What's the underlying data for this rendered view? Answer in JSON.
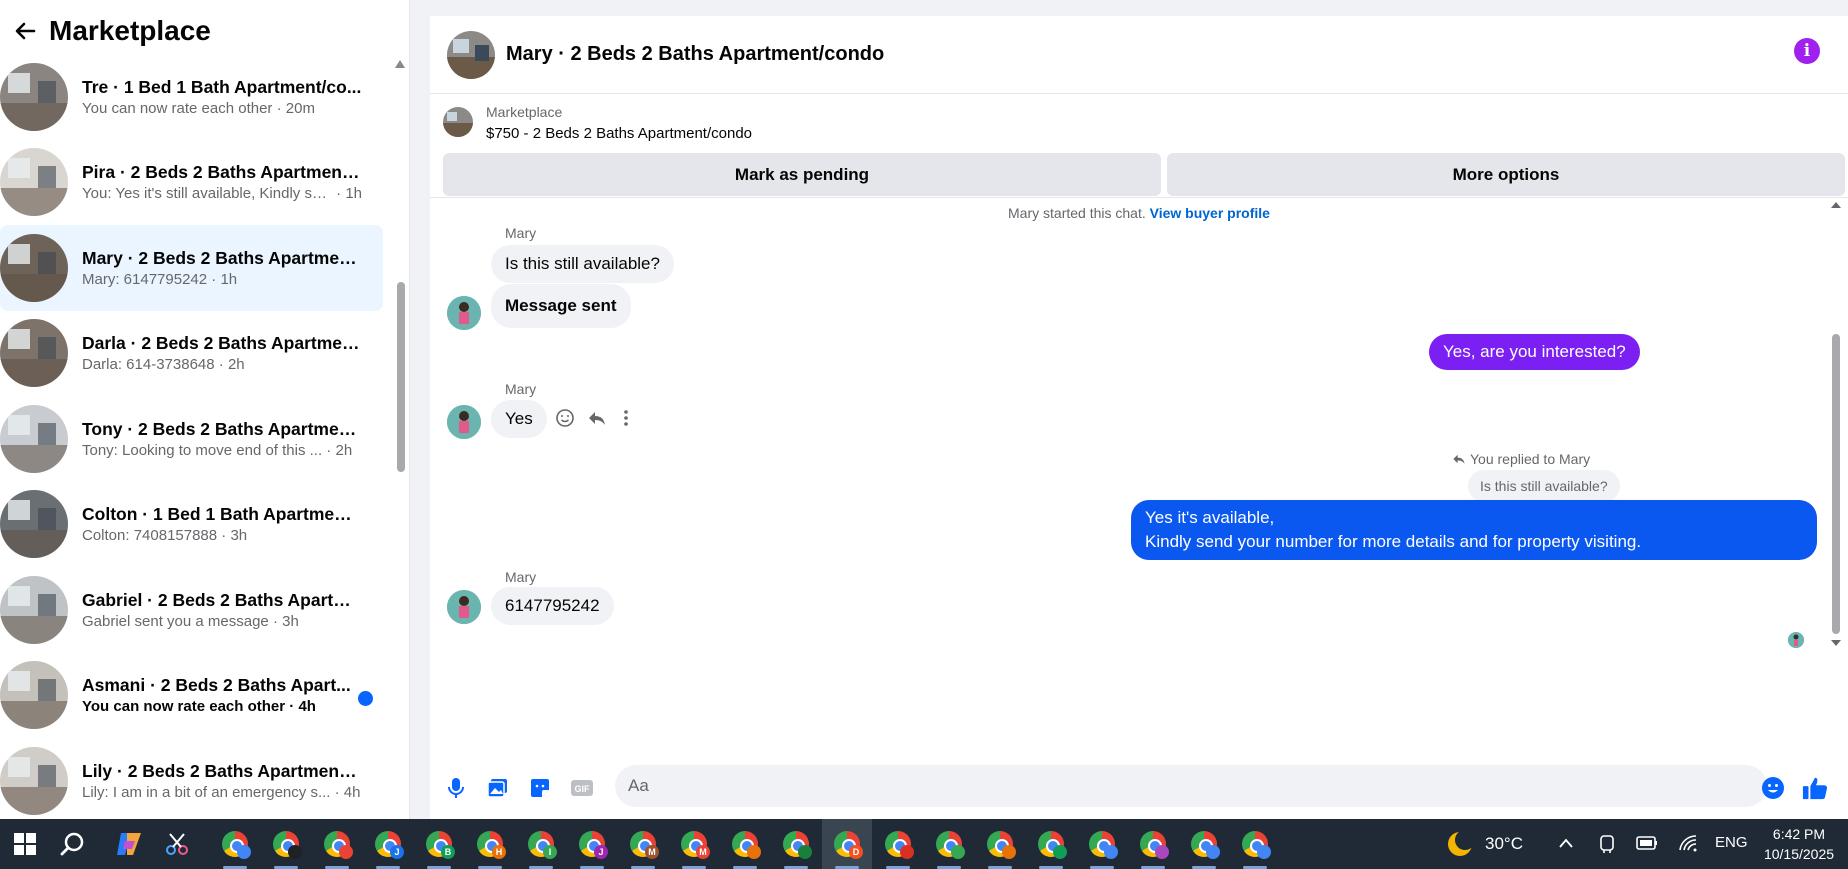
{
  "sidebar": {
    "title": "Marketplace",
    "conversations": [
      {
        "title": "Tre · 1 Bed 1 Bath Apartment/co...",
        "preview": "You can now rate each other",
        "time": "20m",
        "active": false,
        "unread": false
      },
      {
        "title": "Pirа · 2 Beds 2 Baths Apartment...",
        "preview": "You: Yes it's still available, Kindly se...",
        "time": "1h",
        "active": false,
        "unread": false
      },
      {
        "title": "Mary · 2 Beds 2 Baths Apartmen...",
        "preview": "Mary: 6147795242",
        "time": "1h",
        "active": true,
        "unread": false
      },
      {
        "title": "Darla · 2 Beds 2 Baths Apartmen...",
        "preview": "Darla: 614-3738648",
        "time": "2h",
        "active": false,
        "unread": false
      },
      {
        "title": "Tony · 2 Beds 2 Baths Apartmen...",
        "preview": "Tony: Looking to move end of this ...",
        "time": "2h",
        "active": false,
        "unread": false
      },
      {
        "title": "Colton · 1 Bed 1 Bath Apartment...",
        "preview": "Colton: 7408157888",
        "time": "3h",
        "active": false,
        "unread": false
      },
      {
        "title": "Gabriel · 2 Beds 2 Baths Apartm...",
        "preview": "Gabriel sent you a message",
        "time": "3h",
        "active": false,
        "unread": false
      },
      {
        "title": "Asmani · 2 Beds 2 Baths Apart...",
        "preview": "You can now rate each other",
        "time": "4h",
        "active": false,
        "unread": true
      },
      {
        "title": "Lily · 2 Beds 2 Baths Apartment/...",
        "preview": "Lily: I am in a bit of an emergency s...",
        "time": "4h",
        "active": false,
        "unread": false
      }
    ]
  },
  "chat": {
    "title": "Mary · 2 Beds 2 Baths Apartment/condo",
    "listing_source": "Marketplace",
    "listing_title": "$750 - 2 Beds 2 Baths Apartment/condo",
    "mark_pending_label": "Mark as pending",
    "more_options_label": "More options",
    "system_line": "Mary started this chat.",
    "system_link": "View buyer profile",
    "sender_name": "Mary",
    "msg1": "Is this still available?",
    "msg2": "Message sent",
    "msg3": "Yes, are you interested?",
    "msg4": "Yes",
    "reply_note": "You replied to Mary",
    "quoted": "Is this still available?",
    "msg5_line1": "Yes it's available,",
    "msg5_line2": "Kindly send your number for more details and for property visiting.",
    "msg6": "6147795242",
    "input_placeholder": "Aa"
  },
  "taskbar": {
    "temperature": "30°C",
    "language": "ENG",
    "time": "6:42 PM",
    "date": "10/15/2025",
    "badges": [
      "",
      "",
      "",
      "J",
      "B",
      "H",
      "I",
      "J",
      "M",
      "M",
      "",
      "",
      "D",
      "",
      "",
      "",
      "",
      "",
      "",
      "",
      ""
    ]
  },
  "colors": {
    "accent_purple": "#7b1ff2",
    "accent_blue": "#0a58f0",
    "active_row": "#ebf5ff",
    "unread_dot": "#0866ff"
  }
}
